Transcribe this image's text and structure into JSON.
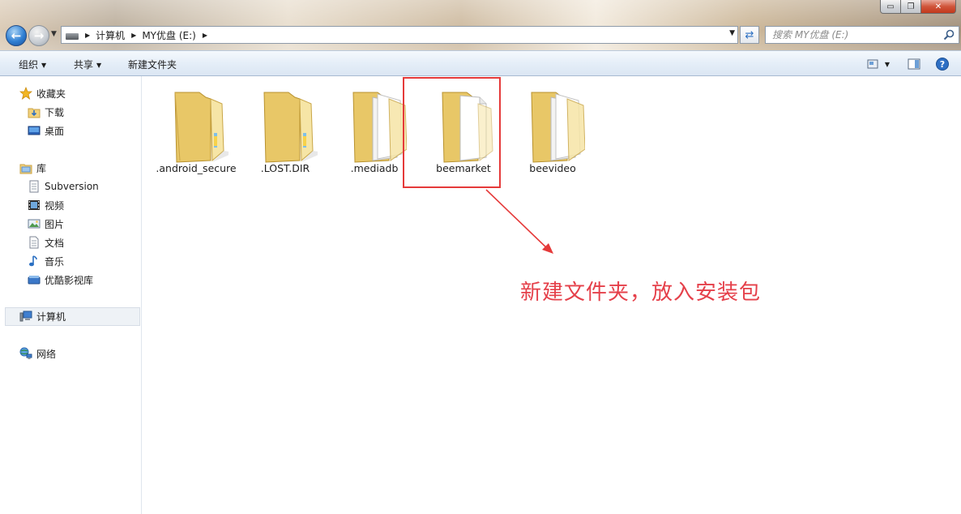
{
  "window": {
    "caption_minimize": "▭",
    "caption_maximize": "❐",
    "caption_close": "✕"
  },
  "navigation": {
    "breadcrumbs": [
      "计算机",
      "MY优盘 (E:)"
    ],
    "search_placeholder": "搜索 MY优盘 (E:)"
  },
  "toolbar": {
    "organize": "组织",
    "share": "共享",
    "new_folder": "新建文件夹"
  },
  "sidebar": {
    "favorites": "收藏夹",
    "downloads": "下载",
    "desktop": "桌面",
    "libraries": "库",
    "subversion": "Subversion",
    "videos": "视频",
    "pictures": "图片",
    "documents": "文档",
    "music": "音乐",
    "youku": "优酷影视库",
    "computer": "计算机",
    "network": "网络"
  },
  "files": [
    {
      "name": ".android_secure",
      "kind": "folder-plain"
    },
    {
      "name": ".LOST.DIR",
      "kind": "folder-plain"
    },
    {
      "name": ".mediadb",
      "kind": "folder-docs"
    },
    {
      "name": "beemarket",
      "kind": "folder-doc"
    },
    {
      "name": "beevideo",
      "kind": "folder-docs"
    }
  ],
  "annotation": {
    "text": "新建文件夹，放入安装包",
    "color": "#e5404a"
  },
  "colors": {
    "accent_blue": "#2f7fd3",
    "highlight_red": "#e53a3a"
  }
}
